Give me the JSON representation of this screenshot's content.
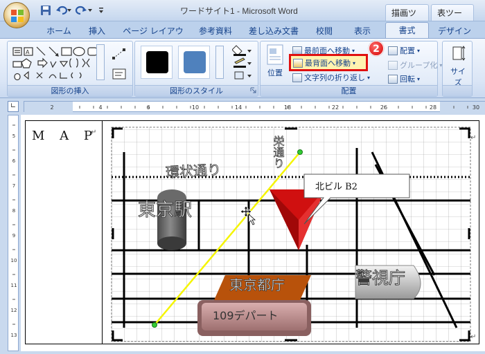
{
  "window": {
    "title": "ワードサイト1 - Microsoft Word",
    "context_tabs": [
      "描画ツール",
      "表ツール"
    ]
  },
  "tabs": [
    {
      "label": "ホーム"
    },
    {
      "label": "挿入"
    },
    {
      "label": "ページ レイアウト"
    },
    {
      "label": "参考資料"
    },
    {
      "label": "差し込み文書"
    },
    {
      "label": "校閲"
    },
    {
      "label": "表示"
    },
    {
      "label": "書式",
      "active": true
    },
    {
      "label": "デザイン"
    }
  ],
  "ribbon": {
    "groups": {
      "insert_shapes": "図形の挿入",
      "shape_styles": "図形のスタイル",
      "arrange": "配置",
      "size": "サイズ"
    },
    "arrange": {
      "bring_front": "最前面へ移動",
      "send_back": "最背面へ移動",
      "text_wrap": "文字列の折り返し",
      "align": "配置",
      "group": "グループ化",
      "rotate": "回転",
      "position": "位置"
    },
    "size_label": "サイズ",
    "badge": "2",
    "style_colors": [
      "#000000",
      "#4f81bd"
    ]
  },
  "document": {
    "map_label": "M A P",
    "labels": {
      "ring_road": "環状通り",
      "sakae_street": "栄通り",
      "tokyo_station": "東京駅",
      "callout": "北ビル B2",
      "metropolitan_office": "東京都庁",
      "police_hq": "警視庁",
      "dept_store": "109デパート"
    }
  },
  "colors": {
    "accent_red": "#e01010",
    "line_yellow": "#f5f500",
    "handle_green": "#33cc33",
    "tocho_orange": "#b8520b",
    "depart_pink": "#c99a9a"
  }
}
